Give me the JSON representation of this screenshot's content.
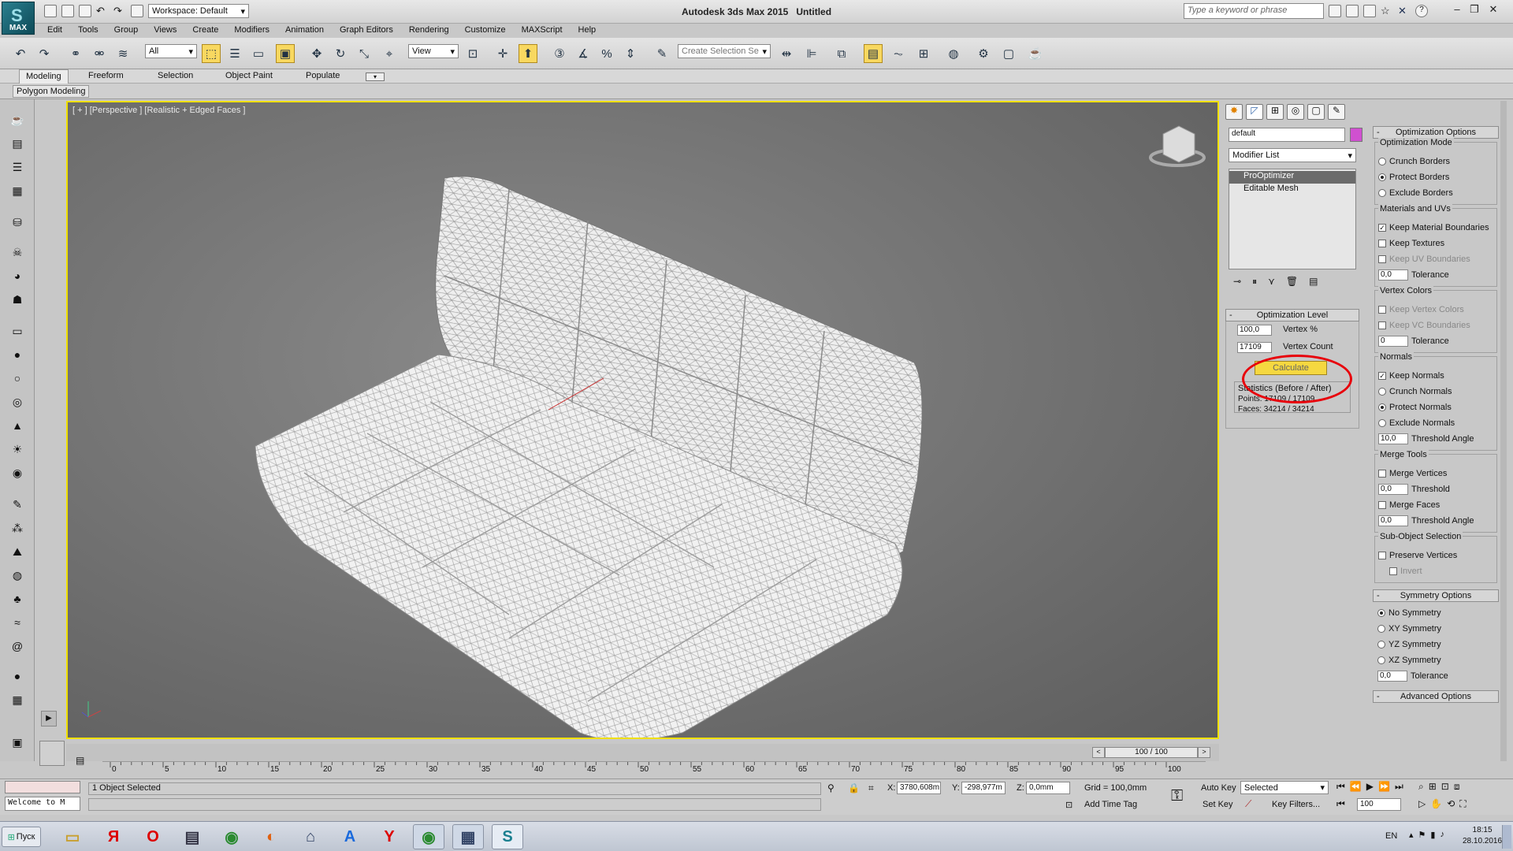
{
  "app": {
    "title": "Autodesk 3ds Max 2015",
    "document": "Untitled",
    "logo": "MAX",
    "workspace": "Workspace: Default",
    "search_placeholder": "Type a keyword or phrase"
  },
  "menu": [
    "Edit",
    "Tools",
    "Group",
    "Views",
    "Create",
    "Modifiers",
    "Animation",
    "Graph Editors",
    "Rendering",
    "Customize",
    "MAXScript",
    "Help"
  ],
  "toolbar": {
    "filter": "All",
    "view": "View",
    "selection_set": "Create Selection Se"
  },
  "ribbon": {
    "tabs": [
      "Modeling",
      "Freeform",
      "Selection",
      "Object Paint",
      "Populate"
    ],
    "subtab": "Polygon Modeling"
  },
  "viewport": {
    "label": "[ + ] [Perspective ] [Realistic + Edged Faces ]"
  },
  "modifier_panel": {
    "object_name": "default",
    "modifier_list": "Modifier List",
    "stack": [
      "ProOptimizer",
      "Editable Mesh"
    ],
    "opt_level": {
      "header": "Optimization Level",
      "vertex_pct": "100,0",
      "vertex_pct_label": "Vertex %",
      "vertex_count": "17109",
      "vertex_count_label": "Vertex Count",
      "calculate": "Calculate",
      "stats_title": "Statistics (Before / After)",
      "points": "Points: 17109 / 17109",
      "faces": "Faces: 34214 / 34214"
    }
  },
  "options": {
    "header": "Optimization Options",
    "mode_group": "Optimization Mode",
    "modes": [
      "Crunch Borders",
      "Protect Borders",
      "Exclude Borders"
    ],
    "mat_group": "Materials and UVs",
    "keep_mat": "Keep Material Boundaries",
    "keep_tex": "Keep Textures",
    "keep_uv": "Keep UV Boundaries",
    "tolerance": "Tolerance",
    "tol_val": "0,0",
    "vc_group": "Vertex Colors",
    "keep_vc": "Keep Vertex Colors",
    "keep_vcb": "Keep VC Boundaries",
    "vc_tol": "0",
    "normals_group": "Normals",
    "keep_normals": "Keep Normals",
    "normal_modes": [
      "Crunch Normals",
      "Protect Normals",
      "Exclude Normals"
    ],
    "threshold_angle": "Threshold Angle",
    "angle_val": "10,0",
    "merge_group": "Merge Tools",
    "merge_vertices": "Merge Vertices",
    "threshold": "Threshold",
    "merge_faces": "Merge Faces",
    "merge_val": "0,0",
    "sub_group": "Sub-Object Selection",
    "preserve": "Preserve Vertices",
    "invert": "Invert",
    "sym_header": "Symmetry Options",
    "symmetry": [
      "No Symmetry",
      "XY Symmetry",
      "YZ Symmetry",
      "XZ Symmetry"
    ],
    "sym_tol": "0,0",
    "adv_header": "Advanced Options"
  },
  "timeline": {
    "frame": "100 / 100",
    "ticks": [
      "0",
      "5",
      "10",
      "15",
      "20",
      "25",
      "30",
      "35",
      "40",
      "45",
      "50",
      "55",
      "60",
      "65",
      "70",
      "75",
      "80",
      "85",
      "90",
      "95",
      "100"
    ]
  },
  "status": {
    "selected": "1 Object Selected",
    "welcome": "Welcome to M",
    "x_label": "X:",
    "x": "3780,608m",
    "y_label": "Y:",
    "y": "-298,977m",
    "z_label": "Z:",
    "z": "0,0mm",
    "grid": "Grid = 100,0mm",
    "add_time_tag": "Add Time Tag",
    "auto_key": "Auto Key",
    "set_key": "Set Key",
    "key_mode": "Selected",
    "key_filters": "Key Filters...",
    "frame_field": "100"
  },
  "taskbar": {
    "start": "Пуск",
    "lang": "EN",
    "time": "18:15",
    "date": "28.10.2016"
  },
  "colors": {
    "viewport_border": "#f0e000",
    "calculate": "#f5d840",
    "highlight_circle": "#e8000a",
    "object_swatch": "#d050d0"
  }
}
